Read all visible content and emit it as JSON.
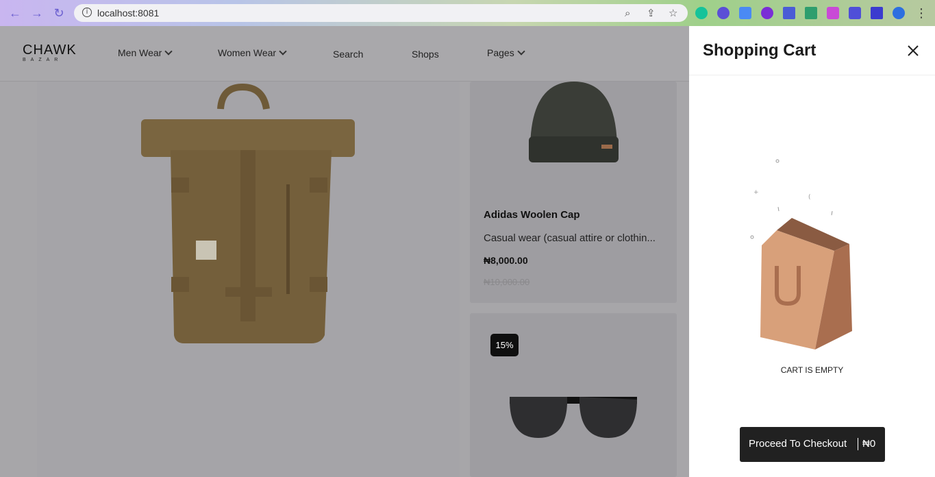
{
  "browser": {
    "url": "localhost:8081",
    "info_icon": "i"
  },
  "header": {
    "logo": {
      "main": "CHAWK",
      "sub": "BAZAR"
    },
    "nav": [
      {
        "label": "Men Wear",
        "dropdown": true
      },
      {
        "label": "Women Wear",
        "dropdown": true
      },
      {
        "label": "Search",
        "dropdown": false
      },
      {
        "label": "Shops",
        "dropdown": false
      },
      {
        "label": "Pages",
        "dropdown": true
      }
    ]
  },
  "products": {
    "hero": {
      "image": "backpack-image"
    },
    "cap": {
      "title": "Adidas Woolen Cap",
      "description": "Casual wear (casual attire or clothin...",
      "price": "₦8,000.00",
      "old_price": "₦10,000.00",
      "image": "woolen-cap-image"
    },
    "sunglasses": {
      "badge": "15%",
      "image": "sunglasses-image"
    }
  },
  "cart": {
    "title": "Shopping Cart",
    "empty_text": "CART IS EMPTY",
    "checkout_label": "Proceed To Checkout",
    "total": "₦0",
    "close_icon": "close-icon",
    "illustration": "empty-bag-illustration"
  },
  "colors": {
    "overlay": "#a7a6a9",
    "drawer_bg": "#ffffff",
    "checkout_bg": "#212121",
    "badge_bg": "#0f0f0f"
  }
}
